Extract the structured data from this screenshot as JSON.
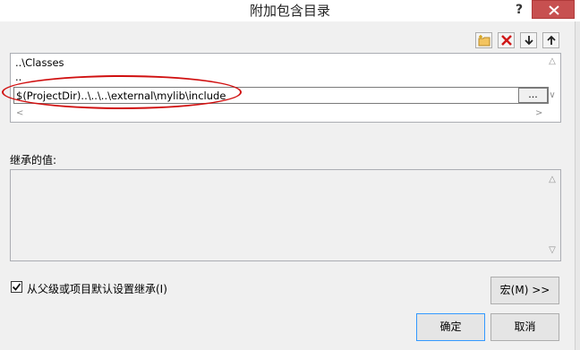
{
  "window": {
    "title": "附加包含目录",
    "help_glyph": "?"
  },
  "toolbar": {
    "icons": [
      "new-folder-icon",
      "delete-icon",
      "move-down-icon",
      "move-up-icon"
    ]
  },
  "directories": {
    "items": [
      "..\\Classes",
      ".."
    ],
    "editing_value": "$(ProjectDir)..\\..\\..\\external\\mylib\\include",
    "browse_label": "..."
  },
  "inherited": {
    "label": "继承的值:"
  },
  "inherit_option": {
    "label": "从父级或项目默认设置继承(I)",
    "checked": true
  },
  "buttons": {
    "macros": "宏(M) >>",
    "ok": "确定",
    "cancel": "取消"
  },
  "colors": {
    "close_button": "#c75050",
    "annotation_oval": "#d01010"
  }
}
